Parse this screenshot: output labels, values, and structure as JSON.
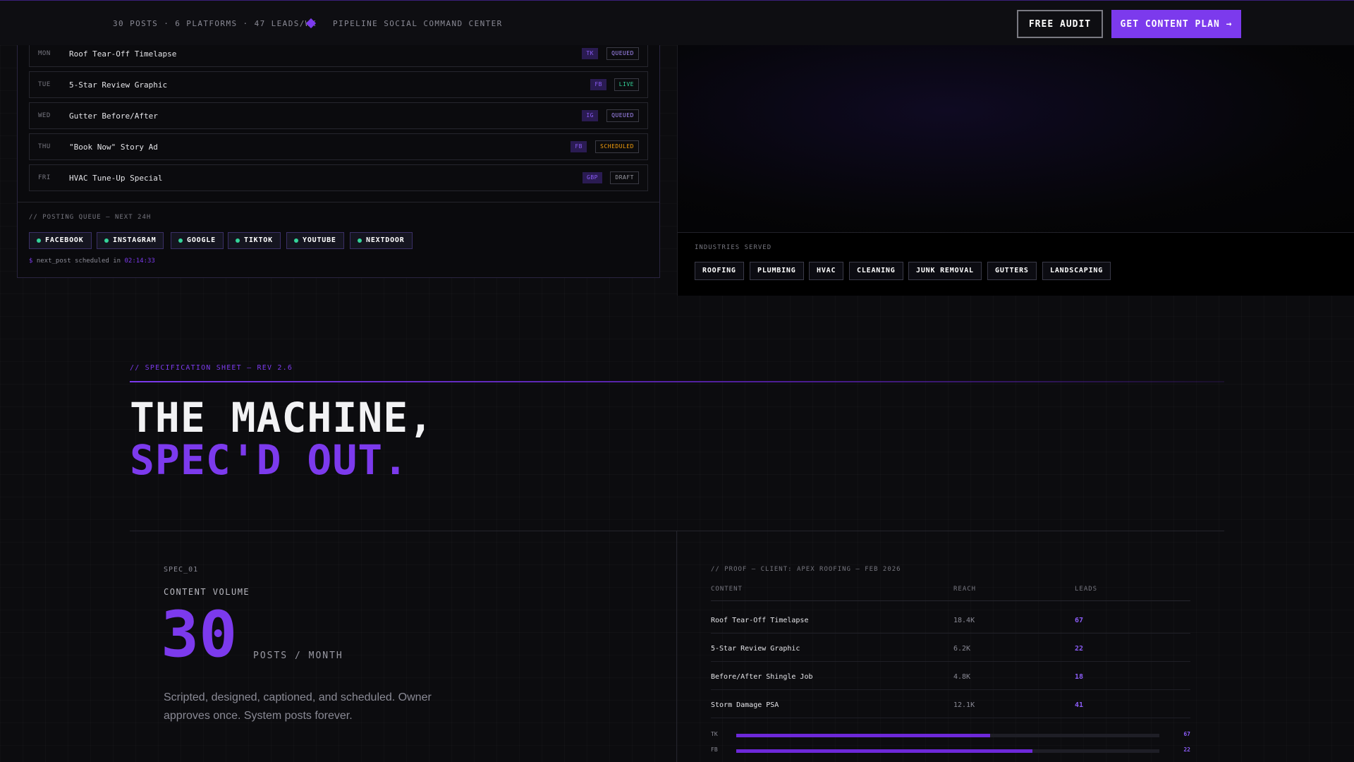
{
  "topbar": {
    "stats": "30 POSTS · 6 PLATFORMS · 47 LEADS/WK",
    "center_title": "PIPELINE SOCIAL COMMAND CENTER",
    "audit_label": "FREE AUDIT",
    "plan_label": "GET CONTENT PLAN →"
  },
  "schedule": [
    {
      "day": "MON",
      "title": "Roof Tear-Off Timelapse",
      "platform": "TK",
      "status": "QUEUED"
    },
    {
      "day": "TUE",
      "title": "5-Star Review Graphic",
      "platform": "FB",
      "status": "LIVE"
    },
    {
      "day": "WED",
      "title": "Gutter Before/After",
      "platform": "IG",
      "status": "QUEUED"
    },
    {
      "day": "THU",
      "title": "\"Book Now\" Story Ad",
      "platform": "FB",
      "status": "SCHEDULED"
    },
    {
      "day": "FRI",
      "title": "HVAC Tune-Up Special",
      "platform": "GBP",
      "status": "DRAFT"
    }
  ],
  "queue": {
    "label": "// POSTING QUEUE — NEXT 24H",
    "platforms": [
      "FACEBOOK",
      "INSTAGRAM",
      "GOOGLE",
      "TIKTOK",
      "YOUTUBE",
      "NEXTDOOR"
    ],
    "next_prompt": "$",
    "next_text": "next_post scheduled in",
    "next_time": "02:14:33"
  },
  "industries": {
    "label": "INDUSTRIES SERVED",
    "items": [
      "ROOFING",
      "PLUMBING",
      "HVAC",
      "CLEANING",
      "JUNK REMOVAL",
      "GUTTERS",
      "LANDSCAPING"
    ]
  },
  "spec": {
    "sub": "// SPECIFICATION SHEET — REV 2.6",
    "headline_1": "THE MACHINE,",
    "headline_2": "SPEC'D OUT.",
    "id": "SPEC_01",
    "name": "CONTENT VOLUME",
    "number": "30",
    "unit": "POSTS / MONTH",
    "description": "Scripted, designed, captioned, and scheduled. Owner approves once. System posts forever."
  },
  "proof": {
    "label": "// PROOF — CLIENT: APEX ROOFING — FEB 2026",
    "headers": [
      "CONTENT",
      "REACH",
      "LEADS"
    ],
    "rows": [
      {
        "content": "Roof Tear-Off Timelapse",
        "reach": "18.4K",
        "leads": "67"
      },
      {
        "content": "5-Star Review Graphic",
        "reach": "6.2K",
        "leads": "22"
      },
      {
        "content": "Before/After Shingle Job",
        "reach": "4.8K",
        "leads": "18"
      },
      {
        "content": "Storm Damage PSA",
        "reach": "12.1K",
        "leads": "41"
      }
    ],
    "bars": [
      {
        "label": "TK",
        "value": "67",
        "fraction": 0.6
      },
      {
        "label": "FB",
        "value": "22",
        "fraction": 0.7
      }
    ]
  },
  "colors": {
    "accent": "#7c3aed",
    "live": "#34d399",
    "scheduled": "#f59e0b"
  }
}
